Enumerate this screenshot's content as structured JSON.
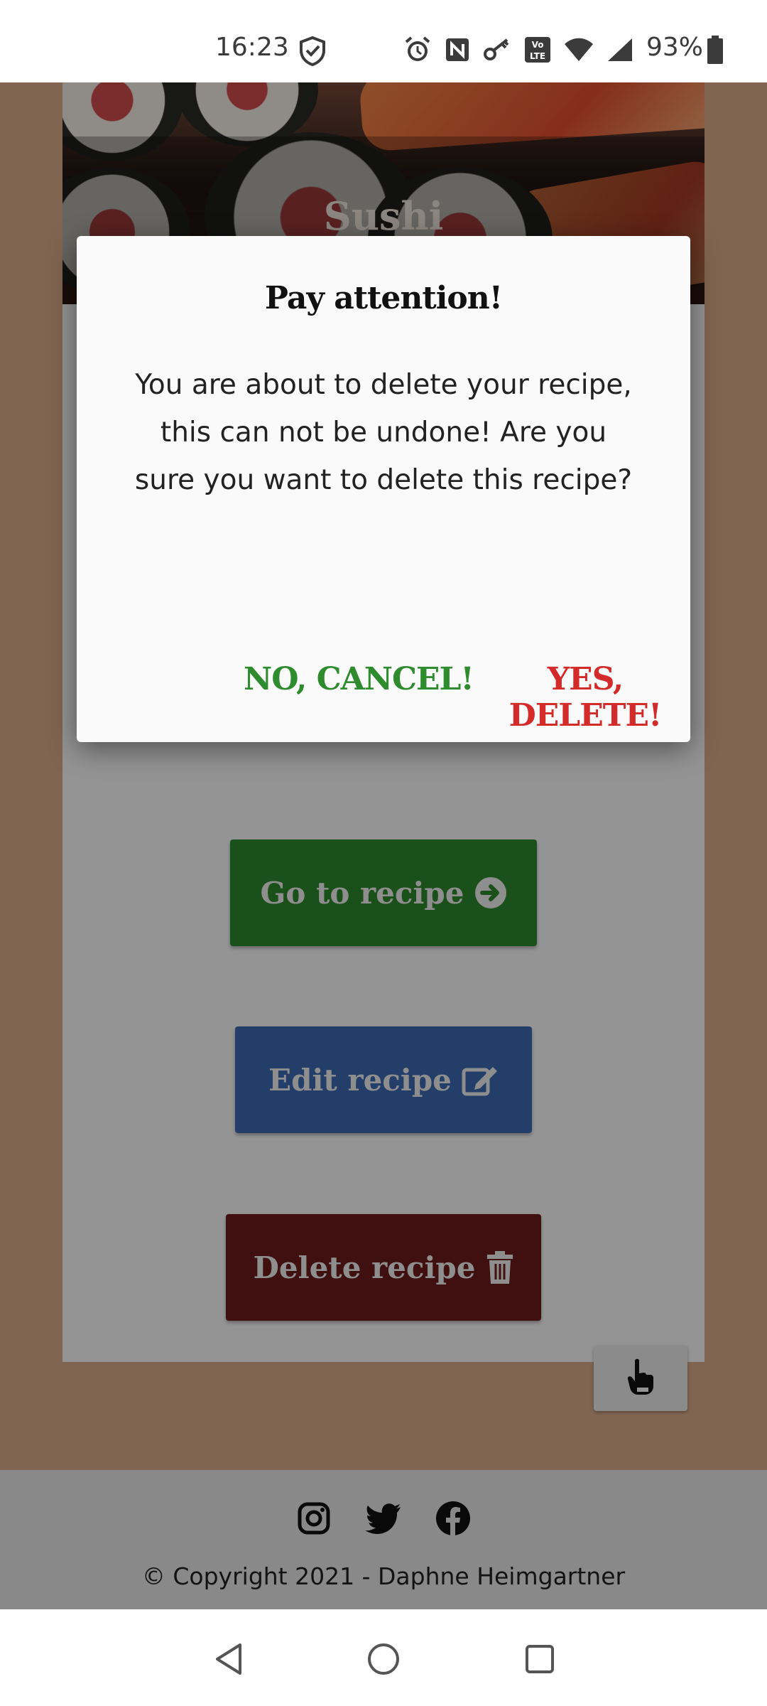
{
  "status_bar": {
    "time": "16:23",
    "battery_percent": "93%",
    "icons": [
      "vpn-shield-icon",
      "alarm-icon",
      "nfc-icon",
      "key-icon",
      "volte-icon",
      "wifi-icon",
      "signal-icon",
      "battery-icon"
    ]
  },
  "hero": {
    "title": "Sushi"
  },
  "card": {
    "buttons": {
      "go_label": "Go to recipe",
      "edit_label": "Edit recipe",
      "delete_label": "Delete recipe"
    }
  },
  "modal": {
    "title": "Pay attention!",
    "message": "You are about to delete your recipe, this can not be undone! Are you sure you want to delete this recipe?",
    "cancel_label": "NO, CANCEL!",
    "confirm_label": "YES, DELETE!"
  },
  "footer": {
    "social_icons": [
      "instagram-icon",
      "twitter-icon",
      "facebook-icon"
    ],
    "copyright": "© Copyright 2021 - Daphne Heimgartner"
  },
  "colors": {
    "page_bg": "#dcae8d",
    "go_button": "#2e8b2e",
    "edit_button": "#3d6bb3",
    "delete_button": "#6f1a1a",
    "cancel_text": "#2e8b2e",
    "confirm_text": "#d32a2a"
  }
}
